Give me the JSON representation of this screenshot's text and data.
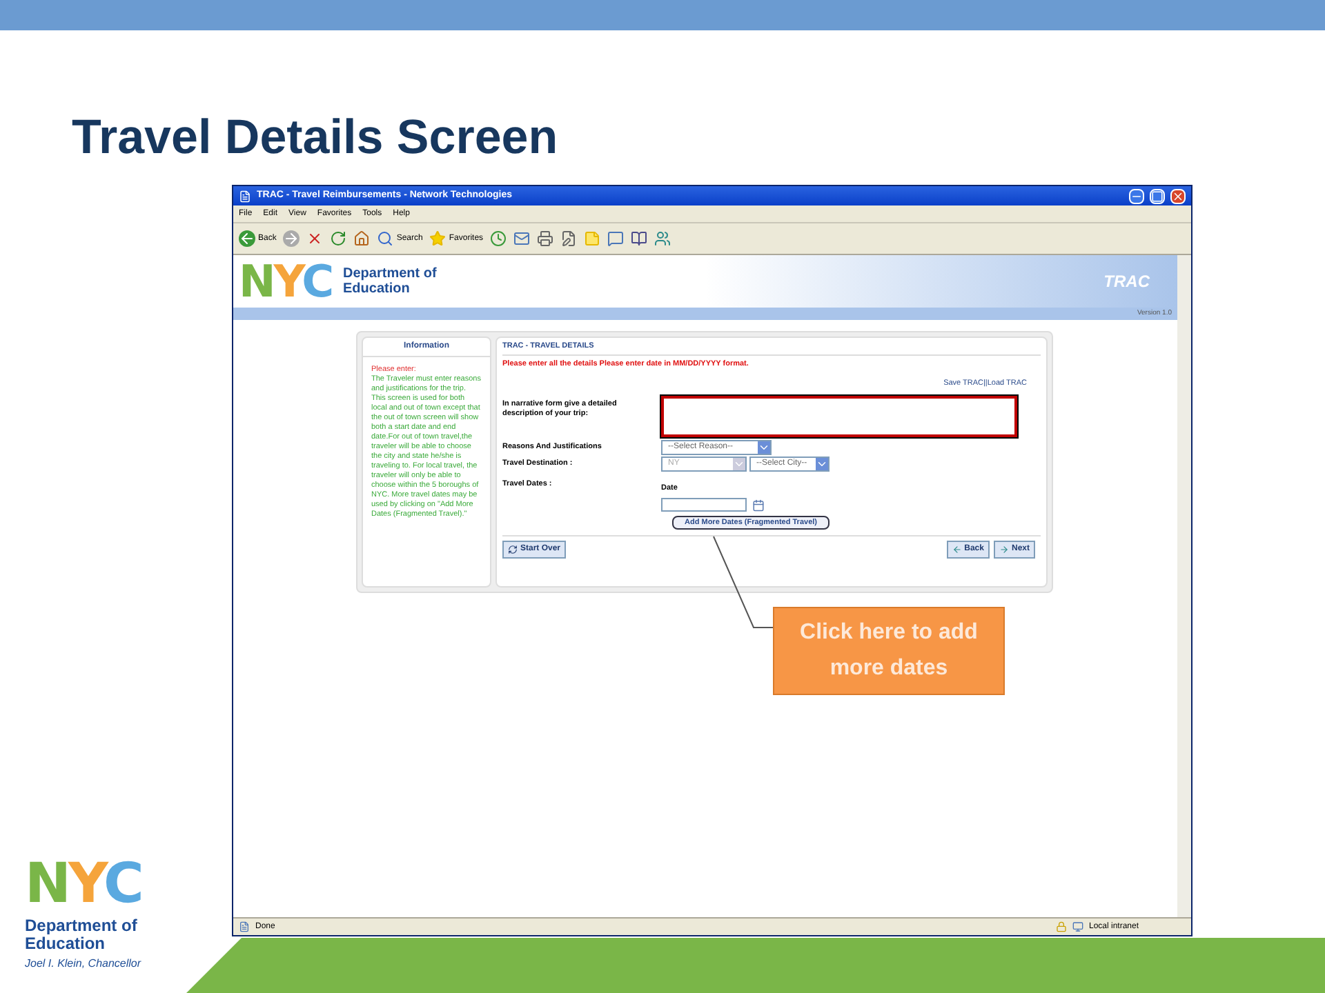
{
  "slide": {
    "title": "Travel Details Screen"
  },
  "logo": {
    "letters": "NYC",
    "line_1": "Department of",
    "line_2": "Education",
    "tagline": "Joel I. Klein, Chancellor"
  },
  "window": {
    "title": "TRAC - Travel Reimbursements - Network Technologies"
  },
  "menu": [
    "File",
    "Edit",
    "View",
    "Favorites",
    "Tools",
    "Help"
  ],
  "toolbar": [
    {
      "kind": "back",
      "label": "Back"
    },
    {
      "kind": "forward"
    },
    {
      "kind": "stop"
    },
    {
      "kind": "refresh"
    },
    {
      "kind": "home"
    },
    {
      "kind": "search",
      "label": "Search"
    },
    {
      "kind": "favorites",
      "label": "Favorites"
    },
    {
      "kind": "history"
    },
    {
      "kind": "mail"
    },
    {
      "kind": "print"
    },
    {
      "kind": "edit"
    },
    {
      "kind": "note"
    },
    {
      "kind": "messenger"
    },
    {
      "kind": "research"
    },
    {
      "kind": "people"
    }
  ],
  "site_header": {
    "logo_letters": "NYC",
    "logo_line_1": "Department of",
    "logo_line_2": "Education",
    "app_name": "TRAC",
    "version": "Version 1.0"
  },
  "info_panel": {
    "heading": "Information",
    "intro": "Please enter:",
    "body": "The Traveler must enter reasons and justifications for the trip. This screen is used for both local and out of town except that the out of town screen will show both a start date and end date.For out of town travel,the traveler will be able to choose the city and state he/she is traveling to. For local travel, the traveler will only be able to choose within the 5 boroughs of NYC. More travel dates may be used by clicking on \"Add More Dates (Fragmented Travel).\""
  },
  "form": {
    "heading": "TRAC - TRAVEL DETAILS",
    "notice": "Please enter all the details Please enter date in MM/DD/YYYY format.",
    "links": [
      "Save TRAC",
      "Load TRAC"
    ],
    "link_separator": "||",
    "narrative_label": "In narrative form give a detailed description of your trip:",
    "reasons_label": "Reasons And Justifications",
    "reason_select": "--Select Reason--",
    "destination_label": "Travel Destination :",
    "state_select": "NY",
    "city_select": "--Select City--",
    "dates_label": "Travel Dates :",
    "date_heading": "Date",
    "add_dates_button": "Add More Dates (Fragmented Travel)",
    "start_over_button": "Start Over",
    "back_button": "Back",
    "next_button": "Next"
  },
  "status_bar": {
    "text": "Done",
    "zone": "Local intranet"
  },
  "callout": {
    "text": "Click here to add more dates"
  }
}
